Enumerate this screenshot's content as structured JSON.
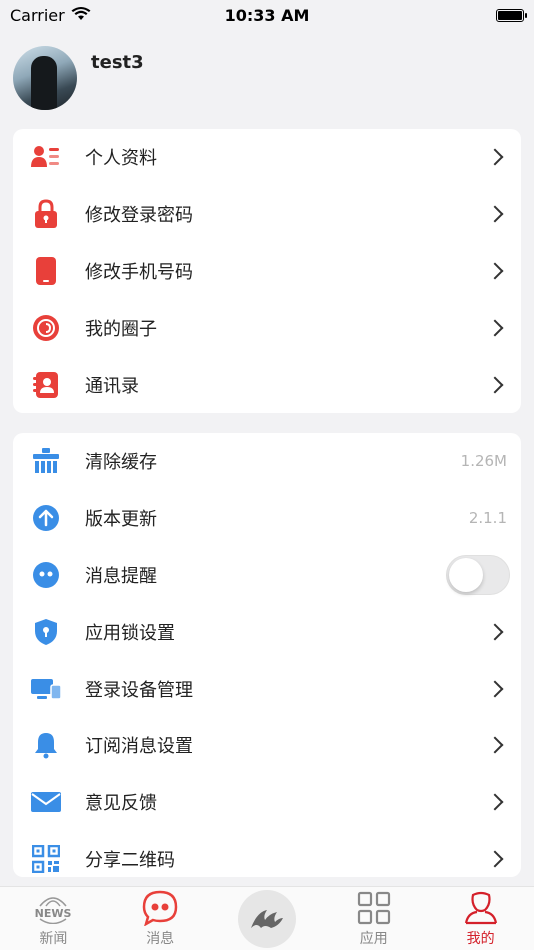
{
  "status_bar": {
    "carrier": "Carrier",
    "time": "10:33 AM"
  },
  "profile": {
    "username": "test3"
  },
  "account_items": [
    {
      "label": "个人资料",
      "icon": "profile-card-icon",
      "color": "#e8403a"
    },
    {
      "label": "修改登录密码",
      "icon": "lock-icon",
      "color": "#e8403a"
    },
    {
      "label": "修改手机号码",
      "icon": "phone-icon",
      "color": "#e8403a"
    },
    {
      "label": "我的圈子",
      "icon": "circle-icon",
      "color": "#e8403a"
    },
    {
      "label": "通讯录",
      "icon": "contacts-icon",
      "color": "#e8403a"
    }
  ],
  "settings_items": [
    {
      "label": "清除缓存",
      "icon": "broom-icon",
      "value": "1.26M",
      "type": "value"
    },
    {
      "label": "版本更新",
      "icon": "upload-arrow-icon",
      "value": "2.1.1",
      "type": "value"
    },
    {
      "label": "消息提醒",
      "icon": "chat-bubble-icon",
      "type": "toggle",
      "enabled": false
    },
    {
      "label": "应用锁设置",
      "icon": "shield-lock-icon",
      "type": "chevron"
    },
    {
      "label": "登录设备管理",
      "icon": "devices-icon",
      "type": "chevron"
    },
    {
      "label": "订阅消息设置",
      "icon": "bell-icon",
      "type": "chevron"
    },
    {
      "label": "意见反馈",
      "icon": "envelope-icon",
      "type": "chevron"
    },
    {
      "label": "分享二维码",
      "icon": "qrcode-icon",
      "type": "chevron"
    }
  ],
  "tabbar": {
    "tabs": [
      {
        "label": "新闻",
        "icon": "news-icon",
        "active": false
      },
      {
        "label": "消息",
        "icon": "message-icon",
        "active": false
      },
      {
        "label": "",
        "icon": "center-logo-icon",
        "active": false
      },
      {
        "label": "应用",
        "icon": "apps-grid-icon",
        "active": false
      },
      {
        "label": "我的",
        "icon": "person-icon",
        "active": true
      }
    ]
  },
  "colors": {
    "accent": "#d4202a",
    "blue": "#3a8ee6"
  }
}
